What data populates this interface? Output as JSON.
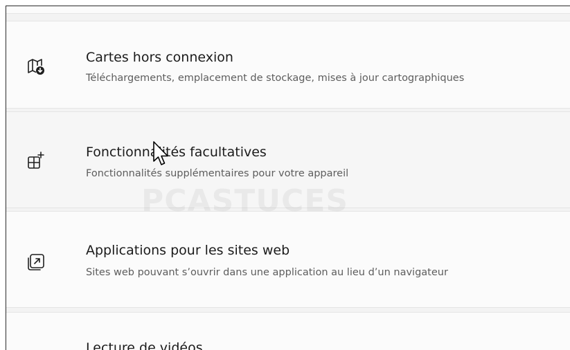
{
  "settings_items": [
    {
      "icon": "offline-map-icon",
      "title": "Cartes hors connexion",
      "description": "Téléchargements, emplacement de stockage, mises à jour cartographiques"
    },
    {
      "icon": "optional-features-icon",
      "title": "Fonctionnalités facultatives",
      "description": "Fonctionnalités supplémentaires pour votre appareil"
    },
    {
      "icon": "apps-for-websites-icon",
      "title": "Applications pour les sites web",
      "description": "Sites web pouvant s’ouvrir dans une application au lieu d’un navigateur"
    },
    {
      "icon": "video-playback-icon",
      "title": "Lecture de vidéos",
      "description": ""
    }
  ],
  "watermark": "PCASTUCES"
}
